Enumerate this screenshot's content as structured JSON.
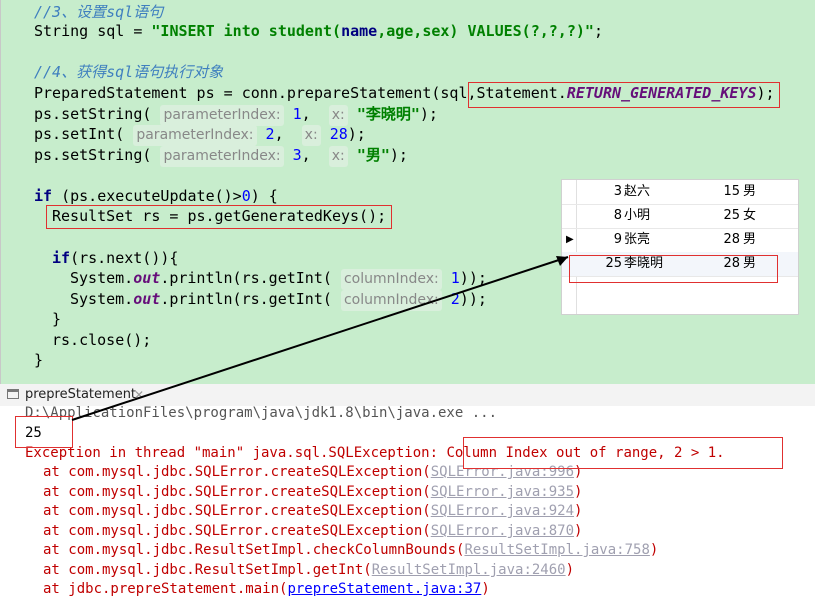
{
  "editor": {
    "comment_3": "//3、设置sql语句",
    "sql_decl_prefix": "String sql = ",
    "sql_string_1": "\"INSERT ",
    "sql_into": "into",
    "sql_string_2": " student(",
    "sql_name": "name",
    "sql_string_3": ",age,sex) VALUES(?,?,?)\"",
    "sql_end": ";",
    "comment_4": "//4、获得sql语句执行对象",
    "ps_decl": "PreparedStatement ps = conn.prepareStatement(sql,",
    "ps_const_class": "Statement.",
    "ps_const": "RETURN_GENERATED_KEYS",
    "ps_end": ");",
    "set1_pre": "ps.setString(",
    "set1_hint1": "parameterIndex:",
    "set1_idx": "1",
    "set1_hint2": "x:",
    "set1_val": "\"李晓明\"",
    "set1_end": ");",
    "set2_pre": "ps.setInt(",
    "set2_hint1": "parameterIndex:",
    "set2_idx": "2",
    "set2_hint2": "x:",
    "set2_val": "28",
    "set2_end": ");",
    "set3_pre": "ps.setString(",
    "set3_hint1": "parameterIndex:",
    "set3_idx": "3",
    "set3_hint2": "x:",
    "set3_val": "\"男\"",
    "set3_end": ");",
    "if1_kw": "if",
    "if1_cond": " (ps.executeUpdate()>",
    "if1_num": "0",
    "if1_end": ") {",
    "rs_decl": "ResultSet rs = ps.getGeneratedKeys();",
    "if2_kw": "if",
    "if2_rest": "(rs.next()){",
    "print1_pre": "System.",
    "print1_out": "out",
    "print1_mid": ".println(rs.getInt(",
    "print1_hint": "columnIndex:",
    "print1_idx": "1",
    "print1_end": "));",
    "print2_pre": "System.",
    "print2_out": "out",
    "print2_mid": ".println(rs.getInt(",
    "print2_hint": "columnIndex:",
    "print2_idx": "2",
    "print2_end": "));",
    "close_inner": "}",
    "rs_close": "rs.close();",
    "close_outer": "}"
  },
  "result_table": {
    "rows": [
      {
        "id": "3",
        "name": "赵六",
        "age": "15",
        "sex": "男"
      },
      {
        "id": "8",
        "name": "小明",
        "age": "25",
        "sex": "女"
      },
      {
        "id": "9",
        "name": "张亮",
        "age": "28",
        "sex": "男"
      },
      {
        "id": "25",
        "name": "李晓明",
        "age": "28",
        "sex": "男"
      }
    ],
    "current_marker": "▶"
  },
  "console": {
    "tab_label": "prepreStatement",
    "tab_close": "✕",
    "command": "D:\\ApplicationFiles\\program\\java\\jdk1.8\\bin\\java.exe ...",
    "output_value": "25",
    "exception_prefix": "Exception in thread \"main\" java.sql.SQLException: ",
    "exception_message": "Column Index out of range, 2 > 1.",
    "stack": [
      {
        "at": "at com.mysql.jdbc.SQLError.createSQLException(",
        "link": "SQLError.java:996",
        "end": ")"
      },
      {
        "at": "at com.mysql.jdbc.SQLError.createSQLException(",
        "link": "SQLError.java:935",
        "end": ")"
      },
      {
        "at": "at com.mysql.jdbc.SQLError.createSQLException(",
        "link": "SQLError.java:924",
        "end": ")"
      },
      {
        "at": "at com.mysql.jdbc.SQLError.createSQLException(",
        "link": "SQLError.java:870",
        "end": ")"
      },
      {
        "at": "at com.mysql.jdbc.ResultSetImpl.checkColumnBounds(",
        "link": "ResultSetImpl.java:758",
        "end": ")"
      },
      {
        "at": "at com.mysql.jdbc.ResultSetImpl.getInt(",
        "link": "ResultSetImpl.java:2460",
        "end": ")"
      },
      {
        "at": "at jdbc.prepreStatement.main(",
        "link": "prepreStatement.java:37",
        "end": ")"
      }
    ]
  },
  "colors": {
    "editor_bg": "#c7edcc",
    "highlight_box": "#e03030",
    "error_text": "#c00000",
    "link": "#0000ff"
  }
}
